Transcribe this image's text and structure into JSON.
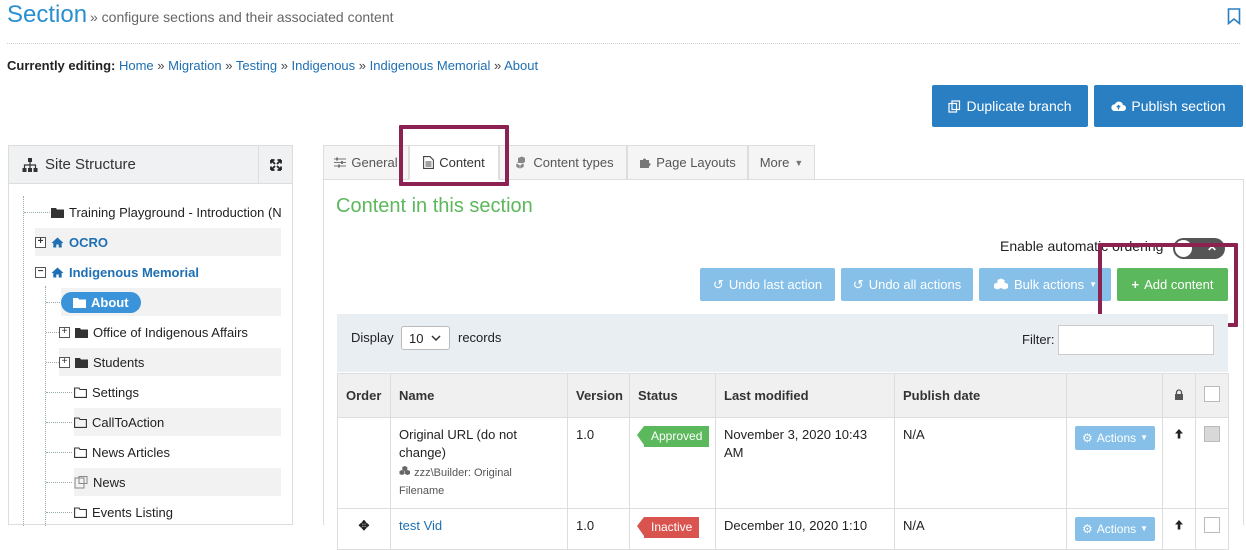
{
  "header": {
    "title": "Section",
    "subtitle": "» configure sections and their associated content"
  },
  "breadcrumb": {
    "label": "Currently editing:",
    "items": [
      "Home",
      "Migration",
      "Testing",
      "Indigenous",
      "Indigenous Memorial",
      "About"
    ],
    "sep": "»"
  },
  "toolbar": {
    "duplicate_label": "Duplicate branch",
    "publish_label": "Publish section"
  },
  "site_structure": {
    "title": "Site Structure",
    "items": [
      {
        "label": "Training Playground - Introduction (N"
      },
      {
        "label": "OCRO"
      },
      {
        "label": "Indigenous Memorial"
      },
      {
        "label": "About"
      },
      {
        "label": "Office of Indigenous Affairs"
      },
      {
        "label": "Students"
      },
      {
        "label": "Settings"
      },
      {
        "label": "CallToAction"
      },
      {
        "label": "News Articles"
      },
      {
        "label": "News"
      },
      {
        "label": "Events Listing"
      }
    ]
  },
  "tabs": [
    {
      "label": "General"
    },
    {
      "label": "Content"
    },
    {
      "label": "Content types"
    },
    {
      "label": "Page Layouts"
    },
    {
      "label": "More"
    }
  ],
  "content": {
    "title": "Content in this section",
    "auto_ordering_label": "Enable automatic ordering",
    "undo_last": "Undo last action",
    "undo_all": "Undo all actions",
    "bulk": "Bulk actions",
    "add": "Add content",
    "display_label": "Display",
    "display_value": "10",
    "records_label": "records",
    "filter_label": "Filter:"
  },
  "table": {
    "headers": [
      "Order",
      "Name",
      "Version",
      "Status",
      "Last modified",
      "Publish date"
    ],
    "rows": [
      {
        "name": "Original URL (do not change)",
        "meta": "zzz\\Builder: Original Filename",
        "version": "1.0",
        "status": "Approved",
        "last_modified": "November 3, 2020 10:43 AM",
        "publish_date": "N/A",
        "actions": "Actions"
      },
      {
        "name": "test Vid",
        "version": "1.0",
        "status": "Inactive",
        "last_modified": "December 10, 2020 1:10",
        "publish_date": "N/A",
        "actions": "Actions"
      }
    ]
  },
  "colors": {
    "primary": "#2a7fc2",
    "light_primary": "#86c0e8",
    "success": "#5cb85c",
    "danger": "#d9534f",
    "highlight_box": "#8b2252"
  }
}
